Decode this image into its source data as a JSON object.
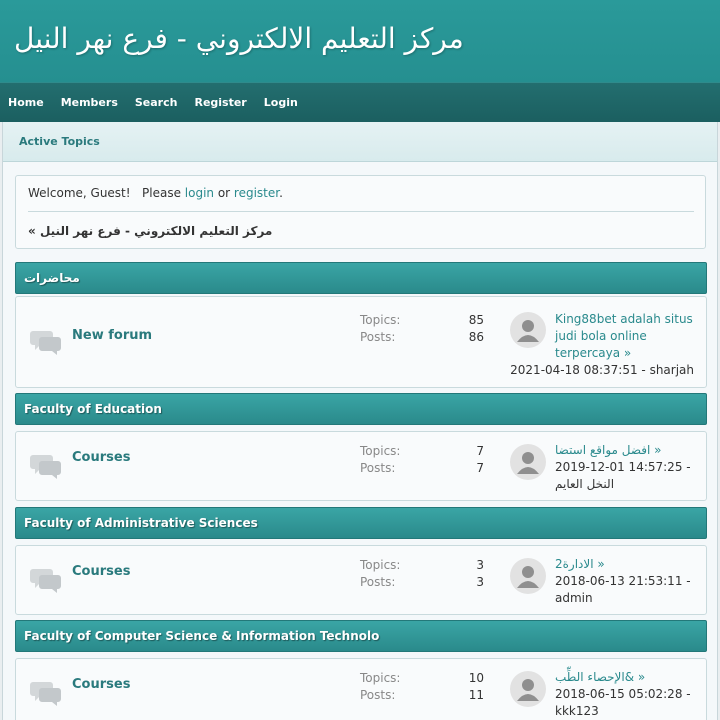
{
  "header": {
    "site_title": "مركز التعليم الالكتروني - فرع نهر النيل"
  },
  "nav": {
    "items": [
      {
        "label": "Home"
      },
      {
        "label": "Members"
      },
      {
        "label": "Search"
      },
      {
        "label": "Register"
      },
      {
        "label": "Login"
      }
    ]
  },
  "subnav": {
    "active_topics": "Active Topics"
  },
  "welcome": {
    "greeting": "Welcome, Guest!   Please ",
    "login": "login",
    "or": " or ",
    "register": "register",
    "period": ".",
    "breadcrumb": "« مركز التعليم الالكتروني - فرع نهر النيل"
  },
  "stat_labels": {
    "topics": "Topics:",
    "posts": "Posts:"
  },
  "categories": [
    {
      "title": "محاضرات",
      "board": {
        "name": "New forum",
        "topics": "85",
        "posts": "86",
        "last_post_title": "King88bet adalah situs judi bola online terpercaya »",
        "last_post_meta": "2021-04-18 08:37:51 - sharjah"
      }
    },
    {
      "title": "Faculty of Education",
      "board": {
        "name": "Courses",
        "topics": "7",
        "posts": "7",
        "last_post_title": "افضل مواقع استضا »",
        "last_post_meta": "2019-12-01 14:57:25 - النخل العايم"
      }
    },
    {
      "title": "Faculty of Administrative Sciences",
      "board": {
        "name": "Courses",
        "topics": "3",
        "posts": "3",
        "last_post_title": "الادارة2 »",
        "last_post_meta": "2018-06-13 21:53:11 - admin"
      }
    },
    {
      "title": "Faculty of Computer Science & Information Technolo",
      "board": {
        "name": "Courses",
        "topics": "10",
        "posts": "11",
        "last_post_title": "الإحصاء الطِّب& »",
        "last_post_meta": "2018-06-15 05:02:28 - kkk123"
      }
    }
  ]
}
